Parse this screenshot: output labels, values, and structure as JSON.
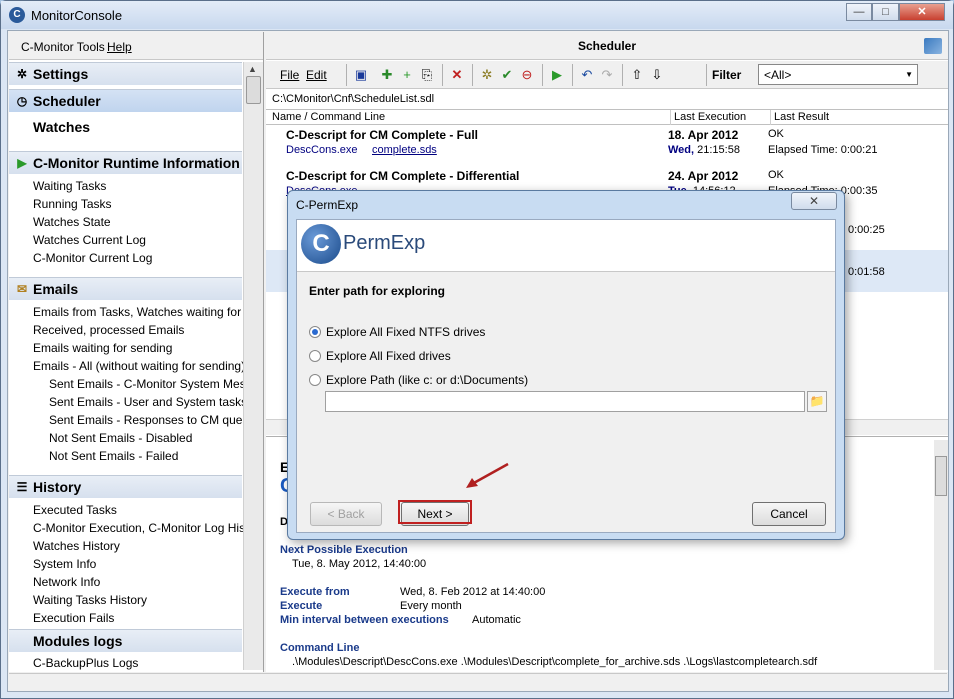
{
  "window": {
    "title": "MonitorConsole",
    "icon": "C",
    "min": "—",
    "max": "□",
    "close": "✕"
  },
  "left": {
    "menu": {
      "tools": "C-Monitor Tools",
      "help": "Help"
    },
    "sections": [
      {
        "label": "Settings",
        "icon": "gear-icon"
      },
      {
        "label": "Scheduler",
        "icon": "clock-icon"
      },
      {
        "label": "Watches"
      },
      {
        "label": "C-Monitor Runtime Information",
        "icon": "play-icon"
      },
      {
        "label": "Emails",
        "icon": "envelope-icon"
      },
      {
        "label": "History",
        "icon": "list-icon"
      },
      {
        "label": "Modules logs"
      }
    ],
    "runtime_items": [
      "Waiting Tasks",
      "Running Tasks",
      "Watches State",
      "Watches Current Log",
      "C-Monitor Current Log"
    ],
    "email_items": [
      "Emails from Tasks, Watches waiting for sending",
      "Received, processed Emails",
      "Emails waiting for sending",
      "Emails - All (without waiting for sending)"
    ],
    "email_subitems": [
      "Sent Emails - C-Monitor System Messages",
      "Sent Emails - User and System tasks Results",
      "Sent Emails - Responses to CM queries",
      "Not Sent Emails - Disabled",
      "Not Sent Emails - Failed"
    ],
    "history_items": [
      "Executed Tasks",
      "C-Monitor Execution, C-Monitor Log History",
      "Watches History",
      "System Info",
      "Network Info",
      "Waiting Tasks History",
      "Execution Fails"
    ],
    "module_items": [
      "C-BackupPlus Logs"
    ]
  },
  "scheduler": {
    "title": "Scheduler",
    "menu_file": "File",
    "menu_edit": "Edit",
    "filter_label": "Filter",
    "filter_value": "<All>",
    "path": "C:\\CMonitor\\Cnf\\ScheduleList.sdl",
    "columns": [
      "Name / Command Line",
      "Last Execution",
      "Last Result"
    ],
    "rows": [
      {
        "title": "C-Descript for CM Complete - Full",
        "exe": "DescCons.exe",
        "arg": "complete.sds",
        "date": "18. Apr 2012",
        "day": "Wed,",
        "time": "21:15:58",
        "result": "OK",
        "elapsed": "Elapsed Time: 0:00:21"
      },
      {
        "title": "C-Descript for CM Complete - Differential",
        "exe": "DescCons.exe",
        "arg": "",
        "date": "24. Apr 2012",
        "day": "Tue,",
        "time": "14:56:12",
        "result": "OK",
        "elapsed": "Elapsed Time: 0:00:35"
      },
      {
        "title": "",
        "exe": "",
        "arg": "",
        "date": "",
        "day": "",
        "time": "",
        "result": "",
        "elapsed": "0:00:25"
      },
      {
        "title": "",
        "exe": "",
        "arg": "",
        "date": "",
        "day": "",
        "time": "",
        "result": "",
        "elapsed": "0:01:58"
      }
    ],
    "detail": {
      "heading_partial": "Es",
      "title_partial": "C",
      "desc_partial": "De",
      "next_label": "Next Possible Execution",
      "next_value": "Tue, 8. May 2012, 14:40:00",
      "from_label": "Execute from",
      "from_value": "Wed, 8. Feb 2012 at 14:40:00",
      "execute_label": "Execute",
      "execute_value": "Every month",
      "min_label": "Min interval between executions",
      "min_value": "Automatic",
      "cmd_label": "Command Line",
      "cmd_value": ".\\Modules\\Descript\\DescCons.exe .\\Modules\\Descript\\complete_for_archive.sds .\\Logs\\lastcompletearch.sdf"
    }
  },
  "dialog": {
    "title": "C-PermExp",
    "close": "✕",
    "logo_letter": "C",
    "logo_text": "PermExp",
    "heading": "Enter path for exploring",
    "options": [
      "Explore All Fixed NTFS drives",
      "Explore All Fixed drives",
      "Explore Path (like c: or d:\\Documents)"
    ],
    "selected_option": 0,
    "path_value": "",
    "back": "< Back",
    "next": "Next >",
    "cancel": "Cancel",
    "highlight_color": "#c02020"
  }
}
